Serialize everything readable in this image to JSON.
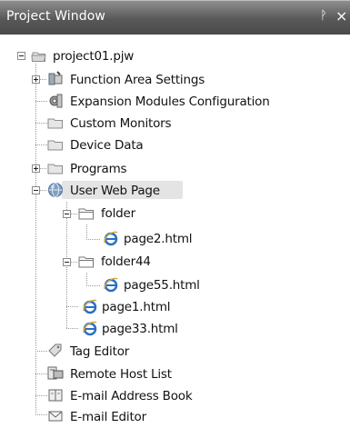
{
  "window": {
    "title": "Project Window",
    "pin_glyph": "ᚹ",
    "close_glyph": "×"
  },
  "tree": {
    "root": {
      "label": "project01.pjw",
      "icon": "folder-open-icon",
      "expanded": true
    },
    "items": [
      {
        "key": "function_area_settings",
        "label": "Function Area Settings",
        "icon": "function-area-icon",
        "expander": "plus"
      },
      {
        "key": "expansion_modules",
        "label": "Expansion Modules Configuration",
        "icon": "gear-icon",
        "expander": "none"
      },
      {
        "key": "custom_monitors",
        "label": "Custom Monitors",
        "icon": "folder-icon",
        "expander": "none"
      },
      {
        "key": "device_data",
        "label": "Device Data",
        "icon": "folder-icon",
        "expander": "none"
      },
      {
        "key": "programs",
        "label": "Programs",
        "icon": "folder-icon",
        "expander": "plus"
      },
      {
        "key": "user_web_page",
        "label": "User Web Page",
        "icon": "globe-icon",
        "expander": "minus",
        "selected": true,
        "children": [
          {
            "key": "folder",
            "label": "folder",
            "icon": "folder-outline-icon",
            "expander": "minus",
            "children": [
              {
                "key": "page2",
                "label": "page2.html",
                "icon": "ie-page-icon"
              }
            ]
          },
          {
            "key": "folder44",
            "label": "folder44",
            "icon": "folder-outline-icon",
            "expander": "minus",
            "children": [
              {
                "key": "page55",
                "label": "page55.html",
                "icon": "ie-page-icon"
              }
            ]
          },
          {
            "key": "page1",
            "label": "page1.html",
            "icon": "ie-page-icon"
          },
          {
            "key": "page33",
            "label": "page33.html",
            "icon": "ie-page-icon"
          }
        ]
      },
      {
        "key": "tag_editor",
        "label": "Tag Editor",
        "icon": "tag-icon",
        "expander": "none"
      },
      {
        "key": "remote_host_list",
        "label": "Remote Host List",
        "icon": "remote-host-icon",
        "expander": "none"
      },
      {
        "key": "email_address_book",
        "label": "E-mail Address Book",
        "icon": "address-book-icon",
        "expander": "none"
      },
      {
        "key": "email_editor",
        "label": "E-mail Editor",
        "icon": "envelope-icon",
        "expander": "none"
      }
    ]
  },
  "colors": {
    "titlebar": "#585858",
    "selection": "#e4e4e4",
    "globe": "#5a7fa8",
    "ie_blue": "#2a6fc1",
    "folder": "#d8d8d8"
  }
}
